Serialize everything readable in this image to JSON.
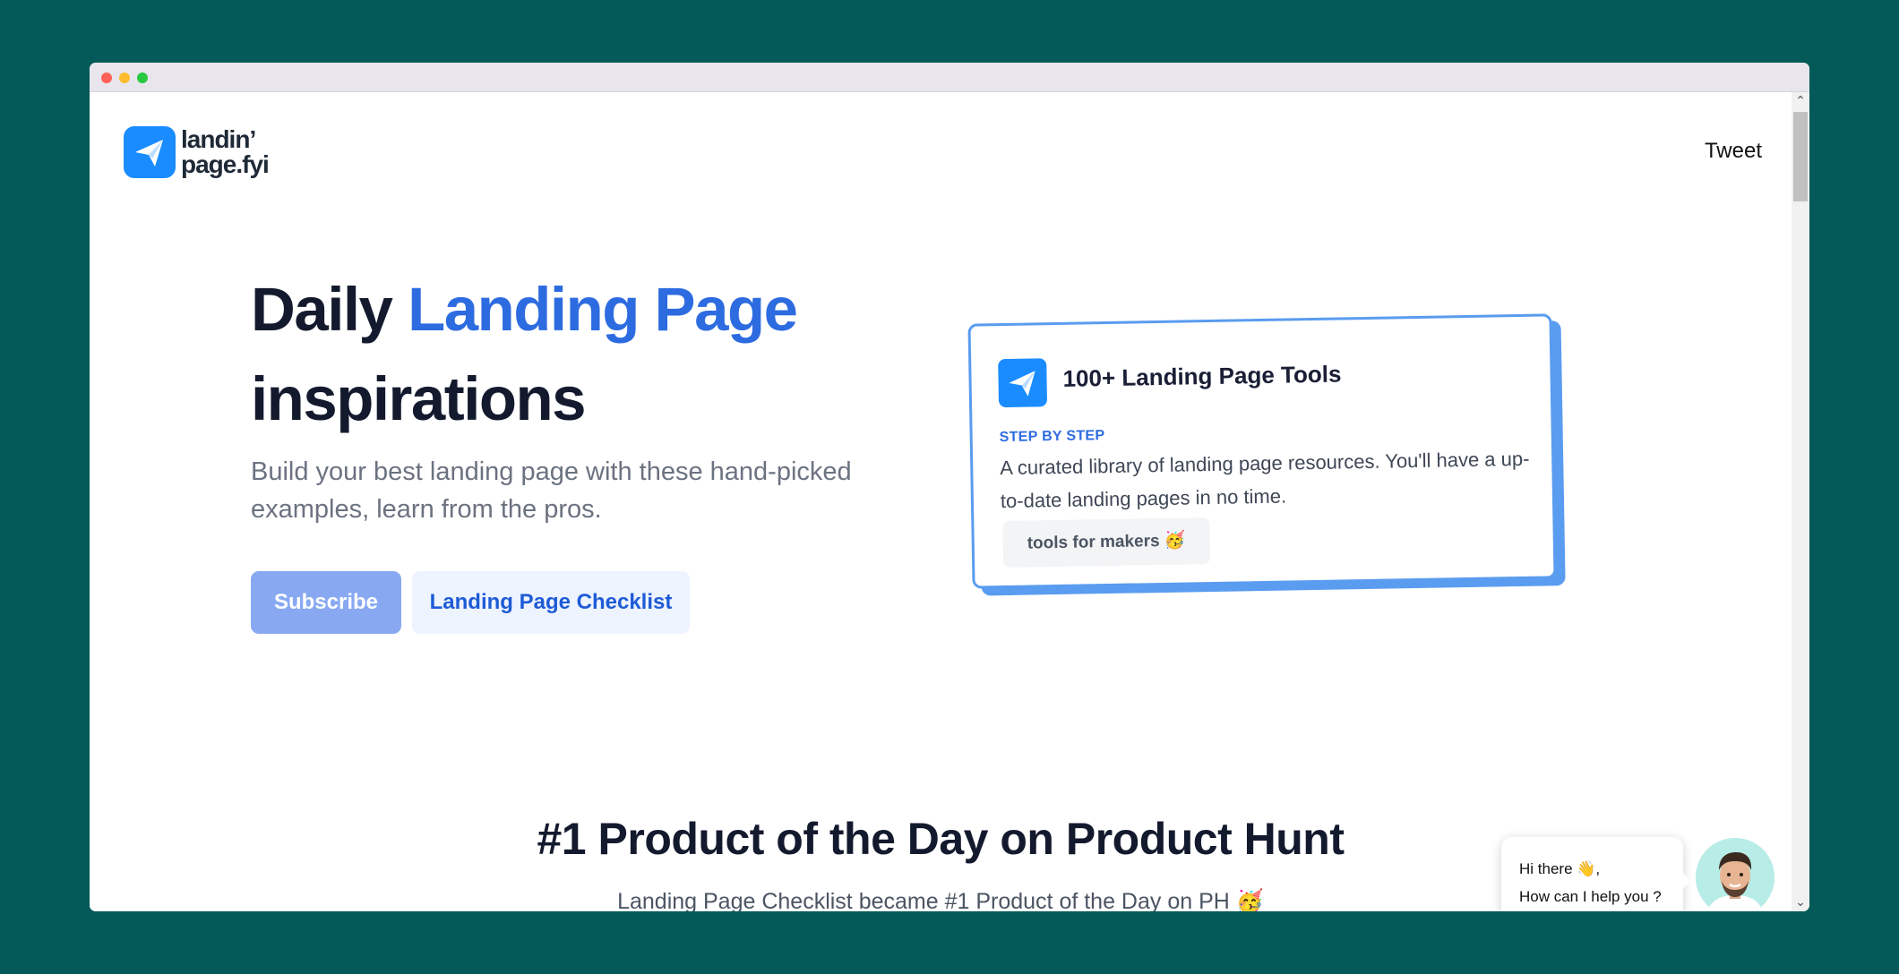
{
  "window": {
    "controls": [
      "close",
      "minimize",
      "maximize"
    ]
  },
  "header": {
    "logo_line1": "landin’",
    "logo_line2": "page.fyi",
    "tweet_label": "Tweet"
  },
  "hero": {
    "title_part1": "Daily ",
    "title_accent": "Landing Page",
    "title_part2": "inspirations",
    "subtitle": "Build your best landing page with these hand-picked examples, learn from the pros.",
    "subscribe_label": "Subscribe",
    "checklist_label": "Landing Page Checklist"
  },
  "card": {
    "title": "100+ Landing Page Tools",
    "eyebrow": "STEP BY STEP",
    "description": "A curated library of landing page resources. You'll have a up-to-date landing pages in no time.",
    "tag": "tools for makers 🥳"
  },
  "product_hunt": {
    "title": "#1 Product of the Day on Product Hunt",
    "subtitle": "Landing Page Checklist became #1 Product of the Day on PH 🥳"
  },
  "chat": {
    "line1": "Hi there 👋,",
    "line2": "How can I help you ?"
  },
  "colors": {
    "background": "#035a58",
    "accent": "#2d6be0",
    "logo_blue": "#1a8cff"
  }
}
